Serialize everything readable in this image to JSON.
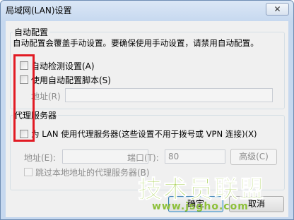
{
  "window": {
    "title": "局域网(LAN)设置",
    "close_glyph": "✕"
  },
  "auto_config": {
    "title": "自动配置",
    "description": "自动配置会覆盖手动设置。要确保使用手动设置，请禁用自动配置。",
    "auto_detect_label": "自动检测设置(A)",
    "auto_detect_checked": false,
    "script_label": "使用自动配置脚本(S)",
    "script_checked": false,
    "address_label": "地址(R)",
    "address_value": ""
  },
  "proxy": {
    "title": "代理服务器",
    "use_proxy_label": "为 LAN 使用代理服务器(这些设置不用于拨号或 VPN 连接)(X)",
    "use_proxy_checked": false,
    "address_label": "地址(E):",
    "address_value": "",
    "port_label": "端口(T):",
    "port_value": "80",
    "advanced_label": "高级(C)",
    "bypass_label": "跳过本地地址的代理服务器(B)",
    "bypass_checked": false
  },
  "buttons": {
    "ok_label": "确定",
    "cancel_label": "取消"
  },
  "watermark": {
    "main": "技术员联盟",
    "sub": "www.jsgho.com"
  },
  "colors": {
    "highlight_box": "#e21b24",
    "watermark": "#9ac93a"
  }
}
